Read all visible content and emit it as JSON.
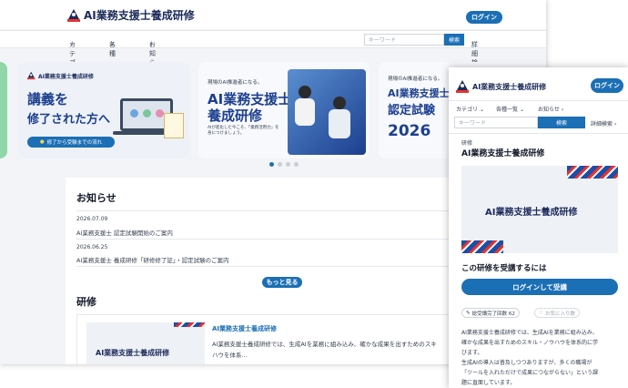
{
  "desktop": {
    "brand": "AI業務支援士養成研修",
    "login": "ログイン",
    "nav": {
      "category": "カテゴリ",
      "list": "各種一覧",
      "notice": "お知らせ"
    },
    "search": {
      "placeholder": "キーワード",
      "button": "検索",
      "advanced": "詳細検索"
    },
    "banner1": {
      "brand": "AI業務支援士養成研修",
      "headline1": "講義を",
      "headline2": "修了された方へ",
      "pill": "修了から受験までの流れ"
    },
    "banner2": {
      "sub": "現場のAI推進者になる。",
      "title1": "AI業務支援士",
      "title2": "養成研修",
      "tagline": "AIが進化した今こそ、「業務活用力」を身につけましょう。"
    },
    "banner3": {
      "sub": "現場のAI推進者になる。",
      "brand": "AI業務支援士養成研修",
      "title1": "AI業務支援士",
      "title2": "認定試験",
      "year": "2026"
    },
    "news": {
      "heading": "お知らせ",
      "items": [
        {
          "date": "2026.07.09",
          "title": "AI業務支援士 認定試験開始のご案内"
        },
        {
          "date": "2026.06.25",
          "title": "AI業務支援士 養成研修「研修修了証」・認定試験のご案内"
        }
      ],
      "more": "もっと見る"
    },
    "training": {
      "heading": "研修",
      "card_title": "AI業務支援士養成研修",
      "card_image": "AI業務支援士養成研修",
      "desc": "AI業務支援士養成研修では、生成AIを業務に組み込み、確かな成果を出すためのスキ",
      "desc2": "ハウを体系…"
    }
  },
  "mobile": {
    "brand": "AI業務支援士養成研修",
    "login": "ログイン",
    "nav": {
      "category": "カテゴリ",
      "list": "各種一覧",
      "notice": "お知らせ"
    },
    "search": {
      "placeholder": "キーワード",
      "button": "検索",
      "advanced": "詳細検索"
    },
    "label": "研修",
    "title": "AI業務支援士養成研修",
    "image_title": "AI業務支援士養成研修",
    "cta_heading": "この研修を受講するには",
    "cta_button": "ログインして受講",
    "completion": "総受講完了回数 62",
    "favorite": "お気に入り数",
    "p1": "AI業務支援士養成研修では、生成AIを業務に組み込み、",
    "p2": "確かな成果を出すためのスキル・ノウハウを体系的に学",
    "p3": "びます。",
    "p4": "生成AIの導入は普及しつつありますが、多くの職場が",
    "p5": "「ツールを入れただけで成果につながらない」という課",
    "p6": "題に直面しています。"
  },
  "colors": {
    "brand_blue": "#1b6fb5",
    "navy": "#1c2a5a",
    "accent_red": "#e3342f"
  }
}
